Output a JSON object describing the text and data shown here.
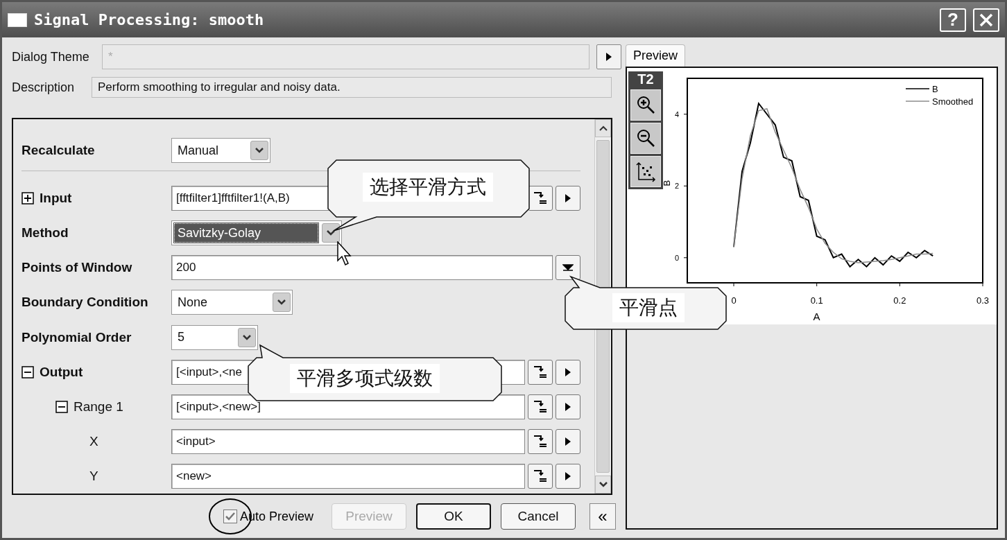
{
  "window": {
    "title": "Signal Processing: smooth",
    "buttons": [
      {
        "kind": "help",
        "label": "?"
      },
      {
        "kind": "close"
      }
    ]
  },
  "theme": {
    "label": "Dialog Theme",
    "placeholder": "*"
  },
  "description": {
    "label": "Description",
    "value": "Perform smoothing to irregular and noisy data."
  },
  "recalculate": {
    "label": "Recalculate",
    "kind": "dropdown",
    "value": "Manual",
    "focused": false
  },
  "rows": [
    {
      "label": "Input",
      "kind": "path",
      "value": "[fftfilter1]fftfilter1!(A,B)",
      "expanded": false,
      "bold": true
    },
    {
      "label": "Method",
      "kind": "dropdown",
      "value": "Savitzky-Golay",
      "focused": true,
      "bold": true
    },
    {
      "label": "Points of Window",
      "kind": "combo",
      "value": "200",
      "bold": true
    },
    {
      "label": "Boundary Condition",
      "kind": "dropdown",
      "value": "None",
      "focused": false,
      "bold": true
    },
    {
      "label": "Polynomial Order",
      "kind": "dropdown",
      "value": "5",
      "focused": false,
      "bold": true
    },
    {
      "label": "Output",
      "kind": "path",
      "value": "[<input>,<ne",
      "expanded": true,
      "bold": true,
      "children": [
        {
          "label": "Range 1",
          "kind": "path",
          "value": "[<input>,<new>]",
          "expanded": true,
          "bold": false,
          "children": [
            {
              "label": "X",
              "kind": "path",
              "value": "<input>",
              "bold": false
            },
            {
              "label": "Y",
              "kind": "path",
              "value": "<new>",
              "bold": false
            }
          ]
        }
      ]
    }
  ],
  "auto_preview": {
    "label": "Auto Preview",
    "checked": true
  },
  "buttons": [
    {
      "label": "Preview",
      "disabled": true,
      "default": false
    },
    {
      "label": "OK",
      "disabled": false,
      "default": true
    },
    {
      "label": "Cancel",
      "disabled": false,
      "default": false
    }
  ],
  "collapse_button": "«",
  "preview": {
    "tab": {
      "label": "Preview",
      "selected": true
    },
    "toolbar_label": "T2",
    "chart_data": {
      "type": "line",
      "xlabel": "A",
      "ylabel": "B",
      "x": [
        0,
        0.01,
        0.02,
        0.03,
        0.04,
        0.05,
        0.06,
        0.07,
        0.08,
        0.09,
        0.1,
        0.11,
        0.12,
        0.13,
        0.14,
        0.15,
        0.16,
        0.17,
        0.18,
        0.19,
        0.2,
        0.21,
        0.22,
        0.23,
        0.24
      ],
      "series": [
        {
          "name": "B",
          "color": "#000000",
          "values": [
            0.3,
            2.4,
            3.2,
            4.3,
            4.0,
            3.7,
            2.8,
            2.7,
            1.7,
            1.6,
            0.6,
            0.5,
            0.0,
            0.1,
            -0.25,
            -0.05,
            -0.25,
            0.0,
            -0.2,
            0.05,
            -0.1,
            0.15,
            0.0,
            0.2,
            0.05
          ]
        },
        {
          "name": "Smoothed",
          "color": "#8c8c8c",
          "values": [
            0.3,
            2.2,
            3.4,
            4.1,
            4.15,
            3.5,
            3.0,
            2.5,
            1.9,
            1.4,
            0.8,
            0.4,
            0.15,
            -0.03,
            -0.1,
            -0.14,
            -0.12,
            -0.1,
            -0.08,
            -0.05,
            0.0,
            0.05,
            0.1,
            0.1,
            0.12
          ]
        }
      ],
      "legend": "upper right",
      "xlim": [
        -0.056,
        0.3
      ],
      "ylim": [
        -0.7,
        5
      ],
      "xticks": [
        0,
        0.1,
        0.2,
        0.3
      ],
      "yticks": [
        0,
        2,
        4
      ]
    }
  },
  "callouts": [
    {
      "text": "选择平滑方式"
    },
    {
      "text": "平滑点"
    },
    {
      "text": "平滑多项式级数"
    }
  ]
}
